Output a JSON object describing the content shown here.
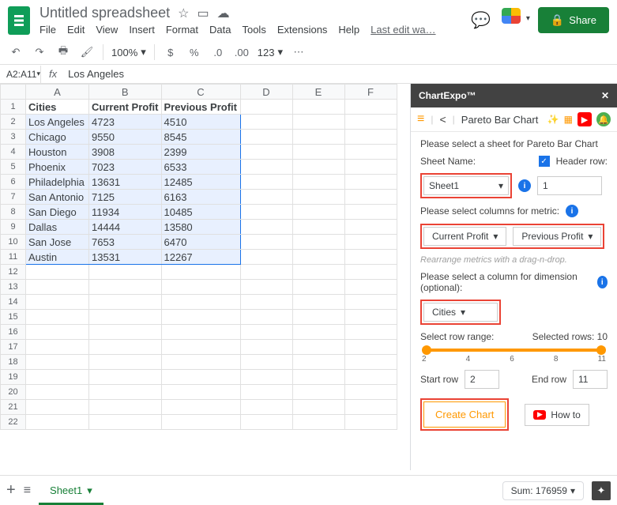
{
  "doc": {
    "title": "Untitled spreadsheet"
  },
  "menus": [
    "File",
    "Edit",
    "View",
    "Insert",
    "Format",
    "Data",
    "Tools",
    "Extensions",
    "Help"
  ],
  "last_edit": "Last edit wa…",
  "share": "Share",
  "toolbar": {
    "zoom": "100%",
    "more": "123"
  },
  "cell_ref": "A2:A11",
  "formula": "Los Angeles",
  "columns": [
    "A",
    "B",
    "C",
    "D",
    "E",
    "F"
  ],
  "headers": [
    "Cities",
    "Current Profit",
    "Previous Profit"
  ],
  "rows": [
    [
      "Los Angeles",
      "4723",
      "4510"
    ],
    [
      "Chicago",
      "9550",
      "8545"
    ],
    [
      "Houston",
      "3908",
      "2399"
    ],
    [
      "Phoenix",
      "7023",
      "6533"
    ],
    [
      "Philadelphia",
      "13631",
      "12485"
    ],
    [
      "San Antonio",
      "7125",
      "6163"
    ],
    [
      "San Diego",
      "11934",
      "10485"
    ],
    [
      "Dallas",
      "14444",
      "13580"
    ],
    [
      "San Jose",
      "7653",
      "6470"
    ],
    [
      "Austin",
      "13531",
      "12267"
    ]
  ],
  "sidebar": {
    "title": "ChartExpo™",
    "chart_type": "Pareto Bar Chart",
    "instruction": "Please select a sheet for Pareto Bar Chart",
    "sheet_name_label": "Sheet Name:",
    "header_row_label": "Header row:",
    "sheet_value": "Sheet1",
    "header_row_value": "1",
    "metric_label": "Please select columns for metric:",
    "metric1": "Current Profit",
    "metric2": "Previous Profit",
    "rearrange_hint": "Rearrange metrics with a drag-n-drop.",
    "dimension_label": "Please select a column for dimension (optional):",
    "dimension_value": "Cities",
    "range_label": "Select row range:",
    "selected_rows": "Selected rows: 10",
    "ticks": [
      "2",
      "4",
      "6",
      "8",
      "11"
    ],
    "start_row_label": "Start row",
    "start_row_value": "2",
    "end_row_label": "End row",
    "end_row_value": "11",
    "create": "Create Chart",
    "howto": "How to"
  },
  "footer": {
    "sheet_tab": "Sheet1",
    "sum": "Sum: 176959"
  }
}
